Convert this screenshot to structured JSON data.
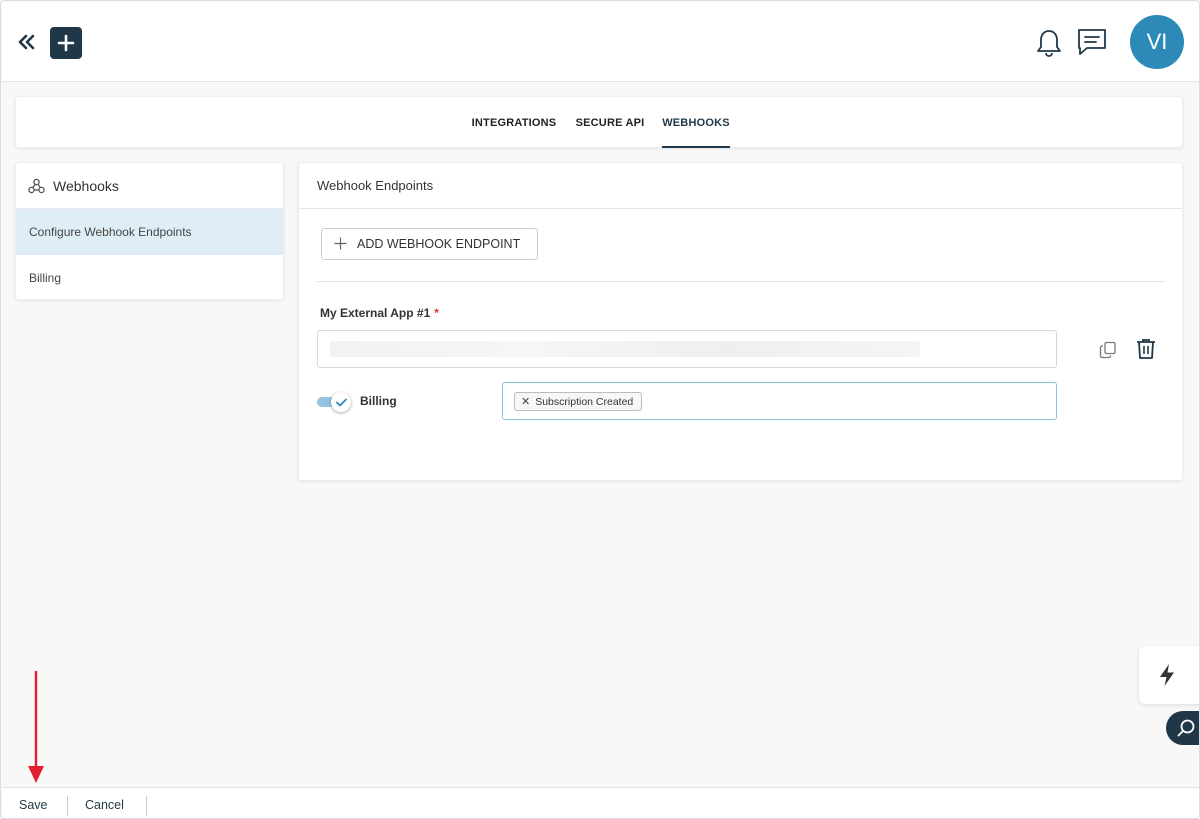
{
  "topbar": {
    "collapse_icon": "double-chevron-left-icon",
    "add_icon": "plus-icon",
    "bell_icon": "bell-icon",
    "chat_icon": "chat-icon",
    "avatar_initials": "VI",
    "avatar_color": "#2d8ab8"
  },
  "tabs": [
    {
      "label": "INTEGRATIONS",
      "active": false
    },
    {
      "label": "SECURE API",
      "active": false
    },
    {
      "label": "WEBHOOKS",
      "active": true
    }
  ],
  "sidebar": {
    "title": "Webhooks",
    "items": [
      {
        "label": "Configure Webhook Endpoints",
        "active": true
      },
      {
        "label": "Billing",
        "active": false
      }
    ]
  },
  "main": {
    "title": "Webhook Endpoints",
    "add_button_label": "ADD WEBHOOK ENDPOINT",
    "endpoint": {
      "name": "My External App #1",
      "required_mark": "*",
      "event_group": "Billing",
      "event_group_enabled": true,
      "selected_events": [
        "Subscription Created"
      ]
    }
  },
  "footer": {
    "save_label": "Save",
    "cancel_label": "Cancel"
  },
  "colors": {
    "primary": "#1f3747",
    "accent": "#2d8ab8",
    "active_row": "#dfeef6",
    "annotation_arrow": "#e0202e"
  }
}
